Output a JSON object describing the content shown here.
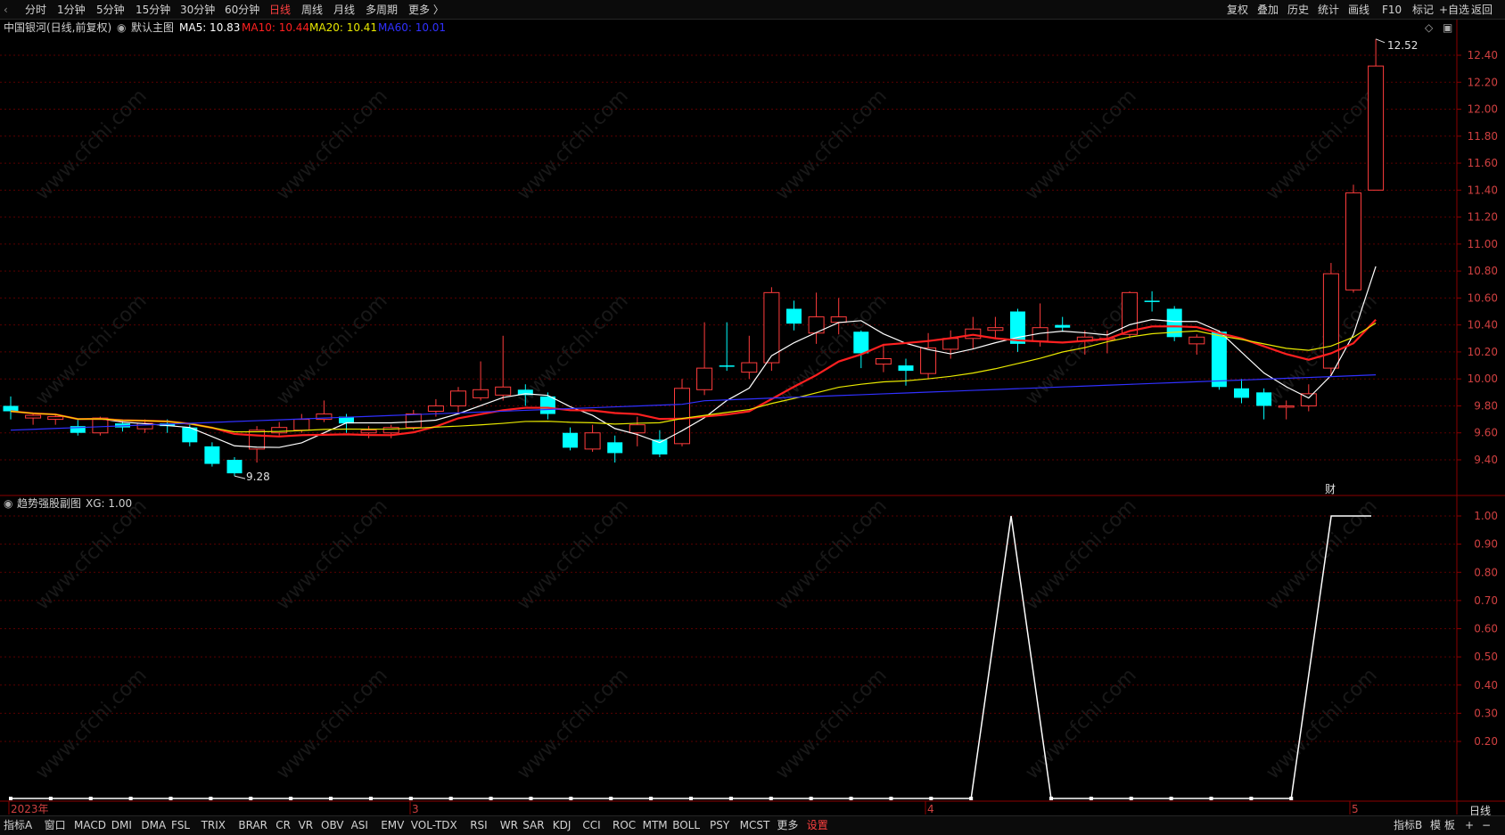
{
  "toolbar": {
    "periods": [
      "分时",
      "1分钟",
      "5分钟",
      "15分钟",
      "30分钟",
      "60分钟",
      "日线",
      "周线",
      "月线",
      "多周期",
      "更多 〉"
    ],
    "active_period": "日线",
    "tools": [
      "复权",
      "叠加",
      "历史",
      "统计",
      "画线",
      "F10",
      "标记",
      "+自选",
      "返回"
    ]
  },
  "main_chart": {
    "stock_name": "中国银河(日线,前复权)",
    "template": "默认主图",
    "ma5_label": "MA5: 10.83",
    "ma10_label": "MA10: 10.44",
    "ma20_label": "MA20: 10.41",
    "ma60_label": "MA60: 10.01",
    "high_label": "12.52",
    "low_label": "9.28",
    "fin_marker": "财",
    "price_ticks": [
      "12.40",
      "12.20",
      "12.00",
      "11.80",
      "11.60",
      "11.40",
      "11.20",
      "11.00",
      "10.80",
      "10.60",
      "10.40",
      "10.20",
      "10.00",
      "9.80",
      "9.60",
      "9.40"
    ]
  },
  "sub_chart": {
    "title": "趋势强股副图",
    "xg_label": "XG: 1.00",
    "ticks": [
      "1.00",
      "0.90",
      "0.80",
      "0.70",
      "0.60",
      "0.50",
      "0.40",
      "0.30",
      "0.20"
    ]
  },
  "date_axis": {
    "labels": [
      "2023年",
      "3",
      "4",
      "5"
    ],
    "period_label": "日线"
  },
  "indicators": [
    "指标A",
    "窗口",
    "MACD",
    "DMI",
    "DMA",
    "FSL",
    "TRIX",
    "BRAR",
    "CR",
    "VR",
    "OBV",
    "ASI",
    "EMV",
    "VOL-TDX",
    "RSI",
    "WR",
    "SAR",
    "KDJ",
    "CCI",
    "ROC",
    "MTM",
    "BOLL",
    "PSY",
    "MCST",
    "更多",
    "设置"
  ],
  "bottom_right": [
    "指标B",
    "模",
    "板",
    "+",
    "−"
  ],
  "watermark": "www.cfchi.com",
  "colors": {
    "up": "#ff3c3c",
    "down": "#00ffff",
    "ma5": "#ffffff",
    "ma10": "#ff2020",
    "ma20": "#e8e800",
    "ma60": "#3030ff",
    "axis": "#8b0000",
    "grid": "#5a0000"
  },
  "chart_data": {
    "type": "candlestick",
    "ylim": [
      9.25,
      12.55
    ],
    "candles": [
      [
        9.8,
        9.76,
        9.87,
        9.7
      ],
      [
        9.71,
        9.73,
        9.74,
        9.66
      ],
      [
        9.7,
        9.72,
        9.74,
        9.66
      ],
      [
        9.65,
        9.6,
        9.7,
        9.58
      ],
      [
        9.6,
        9.71,
        9.72,
        9.58
      ],
      [
        9.67,
        9.64,
        9.7,
        9.61
      ],
      [
        9.63,
        9.67,
        9.7,
        9.6
      ],
      [
        9.67,
        9.65,
        9.7,
        9.6
      ],
      [
        9.64,
        9.53,
        9.66,
        9.5
      ],
      [
        9.5,
        9.37,
        9.53,
        9.35
      ],
      [
        9.4,
        9.3,
        9.42,
        9.28
      ],
      [
        9.48,
        9.62,
        9.65,
        9.38
      ],
      [
        9.6,
        9.64,
        9.68,
        9.58
      ],
      [
        9.62,
        9.7,
        9.74,
        9.6
      ],
      [
        9.7,
        9.74,
        9.84,
        9.68
      ],
      [
        9.72,
        9.67,
        9.74,
        9.6
      ],
      [
        9.6,
        9.62,
        9.65,
        9.56
      ],
      [
        9.6,
        9.64,
        9.66,
        9.56
      ],
      [
        9.64,
        9.74,
        9.77,
        9.62
      ],
      [
        9.76,
        9.8,
        9.85,
        9.72
      ],
      [
        9.8,
        9.91,
        9.94,
        9.74
      ],
      [
        9.86,
        9.92,
        10.13,
        9.84
      ],
      [
        9.88,
        9.94,
        10.32,
        9.84
      ],
      [
        9.92,
        9.88,
        9.96,
        9.8
      ],
      [
        9.87,
        9.74,
        9.9,
        9.7
      ],
      [
        9.6,
        9.49,
        9.64,
        9.47
      ],
      [
        9.48,
        9.6,
        9.66,
        9.46
      ],
      [
        9.53,
        9.45,
        9.58,
        9.38
      ],
      [
        9.6,
        9.66,
        9.72,
        9.5
      ],
      [
        9.55,
        9.44,
        9.62,
        9.42
      ],
      [
        9.52,
        9.93,
        10.0,
        9.5
      ],
      [
        9.92,
        10.08,
        10.42,
        9.88
      ],
      [
        10.1,
        10.09,
        10.42,
        10.06
      ],
      [
        10.05,
        10.12,
        10.32,
        10.0
      ],
      [
        10.12,
        10.64,
        10.68,
        10.06
      ],
      [
        10.52,
        10.41,
        10.58,
        10.36
      ],
      [
        10.34,
        10.46,
        10.64,
        10.26
      ],
      [
        10.42,
        10.46,
        10.6,
        10.33
      ],
      [
        10.35,
        10.19,
        10.36,
        10.08
      ],
      [
        10.11,
        10.15,
        10.26,
        10.05
      ],
      [
        10.1,
        10.06,
        10.15,
        9.95
      ],
      [
        10.04,
        10.23,
        10.34,
        10.0
      ],
      [
        10.22,
        10.3,
        10.36,
        10.15
      ],
      [
        10.3,
        10.37,
        10.46,
        10.22
      ],
      [
        10.36,
        10.38,
        10.46,
        10.3
      ],
      [
        10.5,
        10.26,
        10.52,
        10.2
      ],
      [
        10.28,
        10.38,
        10.56,
        10.24
      ],
      [
        10.4,
        10.38,
        10.46,
        10.35
      ],
      [
        10.28,
        10.31,
        10.36,
        10.18
      ],
      [
        10.3,
        10.3,
        10.36,
        10.19
      ],
      [
        10.33,
        10.64,
        10.65,
        10.3
      ],
      [
        10.58,
        10.57,
        10.65,
        10.5
      ],
      [
        10.52,
        10.31,
        10.54,
        10.28
      ],
      [
        10.26,
        10.31,
        10.33,
        10.18
      ],
      [
        10.35,
        9.94,
        10.36,
        9.92
      ],
      [
        9.93,
        9.86,
        10.0,
        9.82
      ],
      [
        9.9,
        9.8,
        9.93,
        9.7
      ],
      [
        9.8,
        9.8,
        9.84,
        9.7
      ],
      [
        9.8,
        9.89,
        9.96,
        9.76
      ],
      [
        10.08,
        10.78,
        10.86,
        10.03
      ],
      [
        10.66,
        11.38,
        11.44,
        10.64
      ],
      [
        11.4,
        12.32,
        12.52,
        11.4
      ]
    ],
    "xg": [
      0,
      0,
      0,
      0,
      0,
      0,
      0,
      0,
      0,
      0,
      0,
      0,
      0,
      0,
      0,
      0,
      0,
      0,
      0,
      0,
      0,
      0,
      0,
      0,
      0,
      1,
      0,
      0,
      0,
      0,
      0,
      0,
      0,
      1,
      1
    ]
  }
}
